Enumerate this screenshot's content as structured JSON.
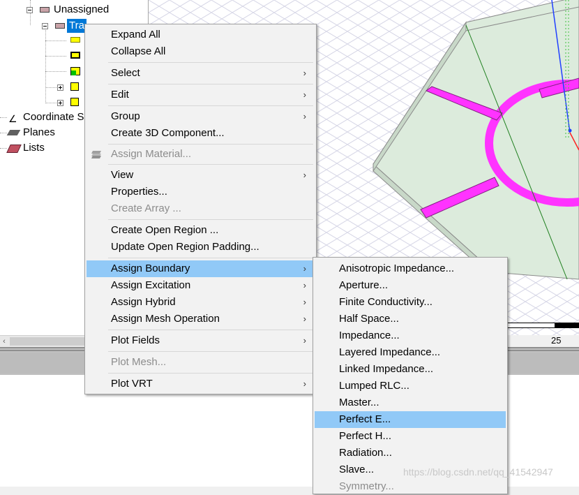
{
  "tree": {
    "unassigned_label": "Unassigned",
    "selected_label": "Tra",
    "coordinate_label": "Coordinate S",
    "planes_label": "Planes",
    "lists_label": "Lists"
  },
  "viewport": {
    "ruler_label": "25",
    "colors": {
      "trace": "#ff33ff",
      "substrate": "#d8ead8",
      "grid": "#d8d8e8"
    }
  },
  "context_menu": {
    "expand_all": "Expand All",
    "collapse_all": "Collapse All",
    "select": "Select",
    "edit": "Edit",
    "group": "Group",
    "create_3d_component": "Create 3D Component...",
    "assign_material": "Assign Material...",
    "view": "View",
    "properties": "Properties...",
    "create_array": "Create Array ...",
    "create_open_region": "Create Open Region ...",
    "update_open_region_padding": "Update Open Region Padding...",
    "assign_boundary": "Assign Boundary",
    "assign_excitation": "Assign Excitation",
    "assign_hybrid": "Assign Hybrid",
    "assign_mesh_operation": "Assign Mesh Operation",
    "plot_fields": "Plot Fields",
    "plot_mesh": "Plot Mesh...",
    "plot_vrt": "Plot VRT",
    "submenu_arrow": "›"
  },
  "boundary_submenu": {
    "items": [
      "Anisotropic Impedance...",
      "Aperture...",
      "Finite Conductivity...",
      "Half Space...",
      "Impedance...",
      "Layered Impedance...",
      "Linked Impedance...",
      "Lumped RLC...",
      "Master...",
      "Perfect E...",
      "Perfect H...",
      "Radiation...",
      "Slave...",
      "Symmetry..."
    ],
    "highlight_color": "#91c9f7"
  },
  "watermark": "https://blog.csdn.net/qq_41542947"
}
